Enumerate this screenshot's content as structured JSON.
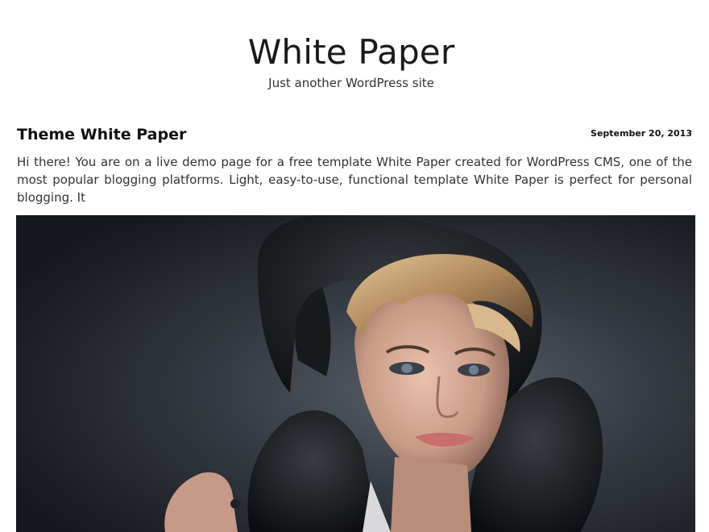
{
  "site": {
    "title": "White Paper",
    "tagline": "Just another WordPress site"
  },
  "post": {
    "title": "Theme White Paper",
    "date": "September 20, 2013",
    "excerpt": "Hi there! You are on a live demo page for a free template White Paper created for WordPress CMS, one of the most popular blogging platforms. Light, easy-to-use, functional template White Paper is perfect for personal blogging. It"
  }
}
